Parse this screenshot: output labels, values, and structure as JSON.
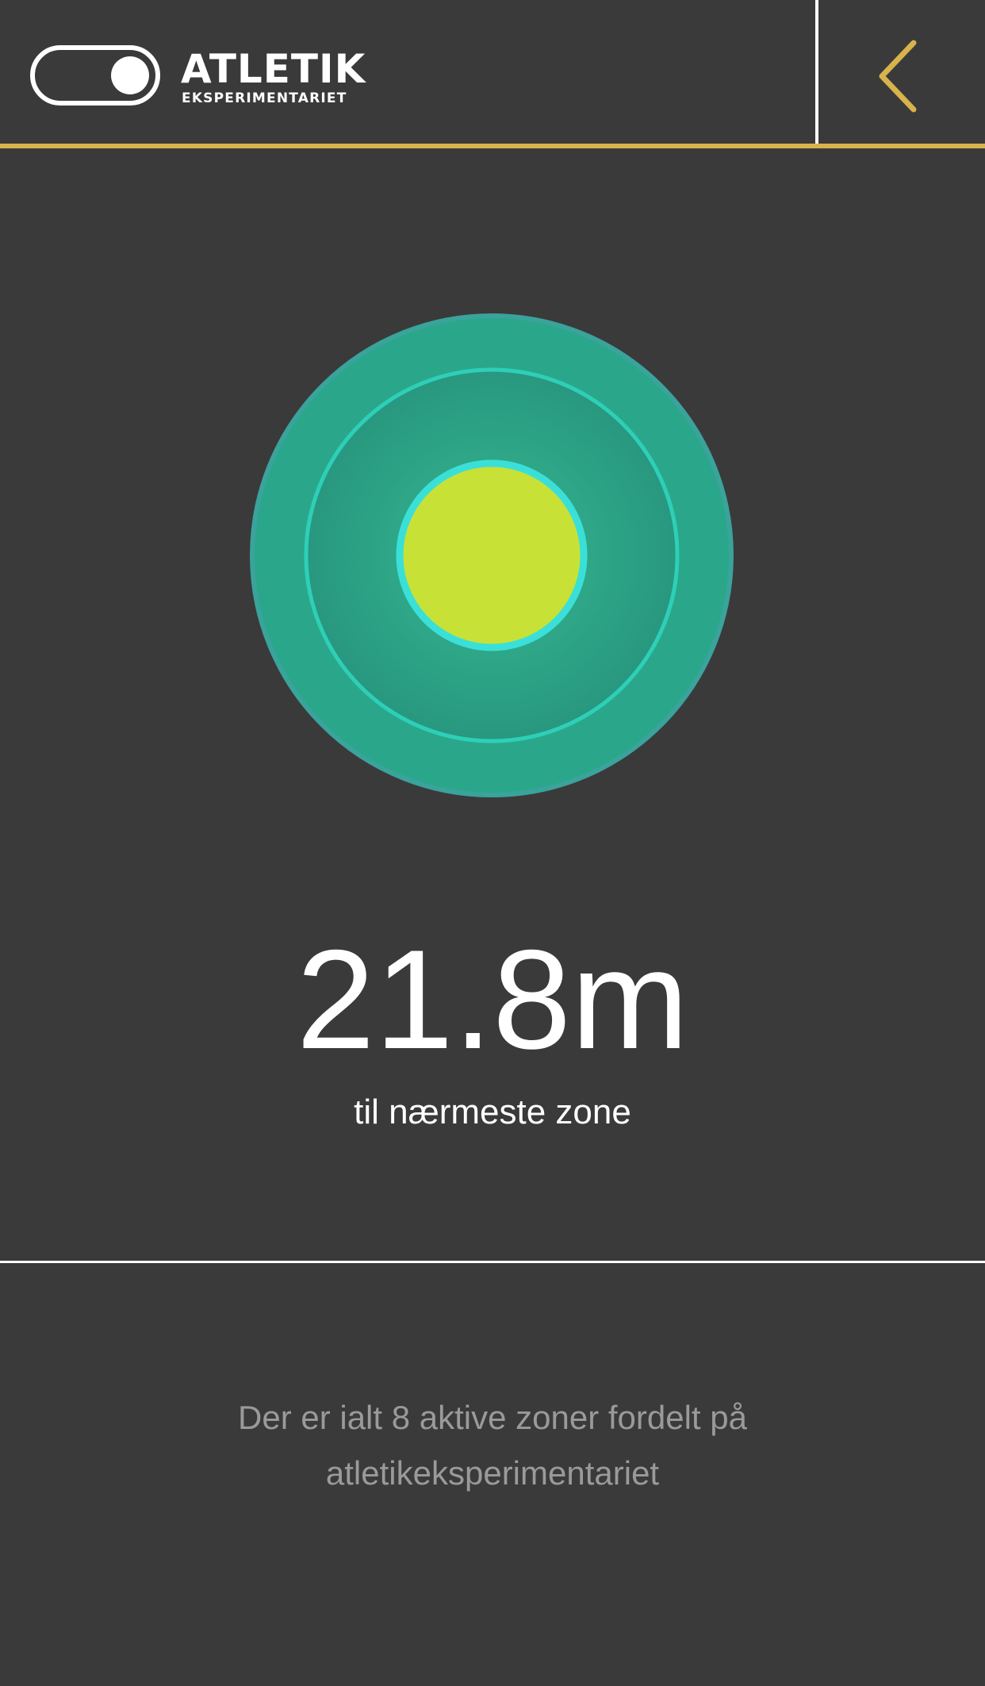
{
  "header": {
    "logo_icon": "toggle-switch-icon",
    "title": "ATLETIK",
    "subtitle": "EKSPERIMENTARIET",
    "back_icon": "chevron-left-icon",
    "accent_color": "#d8b24c"
  },
  "radar": {
    "icon": "proximity-radar-icon",
    "outer_color": "#2ba68a",
    "ring_color": "#2ecfb8",
    "center_color": "#c8e136"
  },
  "distance": {
    "value": "21.8m",
    "caption": "til nærmeste zone"
  },
  "info": {
    "line1": "Der er ialt 8 aktive zoner fordelt på",
    "line2": "atletikeksperimentariet"
  }
}
